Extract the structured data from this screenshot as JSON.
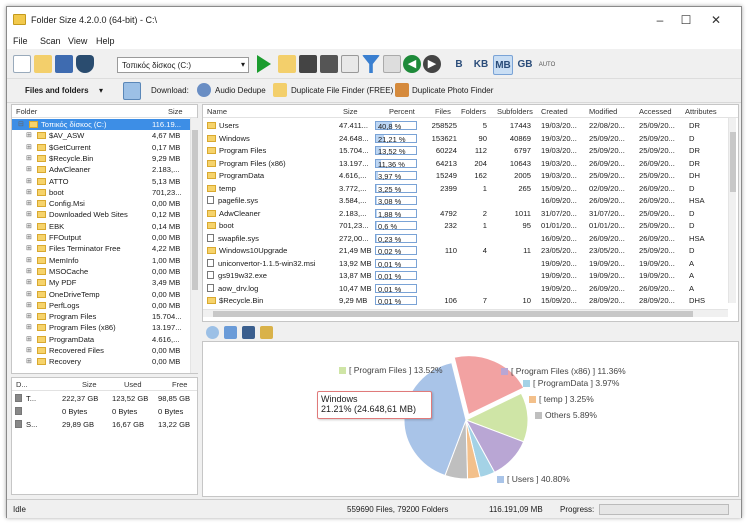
{
  "window": {
    "title": "Folder Size 4.2.0.0 (64-bit) - C:\\"
  },
  "menu": [
    "File",
    "Scan",
    "View",
    "Help"
  ],
  "toolbar": {
    "drive": "Τοπικός δίσκος (C:)",
    "units": [
      "B",
      "KB",
      "MB",
      "GB"
    ],
    "auto_label": "AUTO",
    "selected_unit": "MB"
  },
  "toolbar2": {
    "view": "Files and folders",
    "download": "Download:",
    "audio": "Audio Dedupe",
    "dup_file": "Duplicate File Finder (FREE)",
    "dup_photo": "Duplicate Photo Finder"
  },
  "tree": {
    "headers": [
      "Folder",
      "Size"
    ],
    "items": [
      {
        "name": "Τοπικός δίσκος (C:)",
        "size": "116.19..."
      },
      {
        "name": "$AV_ASW",
        "size": "4,67 MB"
      },
      {
        "name": "$GetCurrent",
        "size": "0,17 MB"
      },
      {
        "name": "$Recycle.Bin",
        "size": "9,29 MB"
      },
      {
        "name": "AdwCleaner",
        "size": "2.183,..."
      },
      {
        "name": "ATTO",
        "size": "5,13 MB"
      },
      {
        "name": "boot",
        "size": "701,23..."
      },
      {
        "name": "Config.Msi",
        "size": "0,00 MB"
      },
      {
        "name": "Downloaded Web Sites",
        "size": "0,12 MB"
      },
      {
        "name": "EBK",
        "size": "0,14 MB"
      },
      {
        "name": "FFOutput",
        "size": "0,00 MB"
      },
      {
        "name": "Files Terminator Free",
        "size": "4,22 MB"
      },
      {
        "name": "MemInfo",
        "size": "1,00 MB"
      },
      {
        "name": "MSOCache",
        "size": "0,00 MB"
      },
      {
        "name": "My PDF",
        "size": "3,49 MB"
      },
      {
        "name": "OneDriveTemp",
        "size": "0,00 MB"
      },
      {
        "name": "PerfLogs",
        "size": "0,00 MB"
      },
      {
        "name": "Program Files",
        "size": "15.704..."
      },
      {
        "name": "Program Files (x86)",
        "size": "13.197..."
      },
      {
        "name": "ProgramData",
        "size": "4.616,..."
      },
      {
        "name": "Recovered Files",
        "size": "0,00 MB"
      },
      {
        "name": "Recovery",
        "size": "0,00 MB"
      }
    ]
  },
  "drives": {
    "headers": [
      "D...",
      "Size",
      "Used",
      "Free"
    ],
    "rows": [
      {
        "d": "T...",
        "size": "222,37 GB",
        "used": "123,52 GB",
        "free": "98,85 GB"
      },
      {
        "d": "",
        "size": "0 Bytes",
        "used": "0 Bytes",
        "free": "0 Bytes"
      },
      {
        "d": "S...",
        "size": "29,89 GB",
        "used": "16,67 GB",
        "free": "13,22 GB"
      }
    ]
  },
  "list": {
    "headers": [
      "Name",
      "Size",
      "Percent",
      "Files",
      "Folders",
      "Subfolders",
      "Created",
      "Modified",
      "Accessed",
      "Attributes"
    ],
    "rows": [
      {
        "name": "Users",
        "size": "47.411...",
        "pct": "40,8 %",
        "p": 40.8,
        "files": "258525",
        "folders": "5",
        "sub": "17443",
        "created": "19/03/20...",
        "modified": "22/08/20...",
        "accessed": "25/09/20...",
        "attr": "DR",
        "type": "folder"
      },
      {
        "name": "Windows",
        "size": "24.648...",
        "pct": "21,21 %",
        "p": 21.21,
        "files": "153621",
        "folders": "90",
        "sub": "40869",
        "created": "19/03/20...",
        "modified": "25/09/20...",
        "accessed": "25/09/20...",
        "attr": "D",
        "type": "folder"
      },
      {
        "name": "Program Files",
        "size": "15.704...",
        "pct": "13,52 %",
        "p": 13.52,
        "files": "60224",
        "folders": "112",
        "sub": "6797",
        "created": "19/03/20...",
        "modified": "25/09/20...",
        "accessed": "25/09/20...",
        "attr": "DR",
        "type": "folder"
      },
      {
        "name": "Program Files (x86)",
        "size": "13.197...",
        "pct": "11,36 %",
        "p": 11.36,
        "files": "64213",
        "folders": "204",
        "sub": "10643",
        "created": "19/03/20...",
        "modified": "26/09/20...",
        "accessed": "26/09/20...",
        "attr": "DR",
        "type": "folder"
      },
      {
        "name": "ProgramData",
        "size": "4.616,...",
        "pct": "3,97 %",
        "p": 3.97,
        "files": "15249",
        "folders": "162",
        "sub": "2005",
        "created": "19/03/20...",
        "modified": "25/09/20...",
        "accessed": "25/09/20...",
        "attr": "DH",
        "type": "folder"
      },
      {
        "name": "temp",
        "size": "3.772,...",
        "pct": "3,25 %",
        "p": 3.25,
        "files": "2399",
        "folders": "1",
        "sub": "265",
        "created": "15/09/20...",
        "modified": "02/09/20...",
        "accessed": "26/09/20...",
        "attr": "D",
        "type": "folder"
      },
      {
        "name": "pagefile.sys",
        "size": "3.584,...",
        "pct": "3,08 %",
        "p": 3.08,
        "files": "",
        "folders": "",
        "sub": "",
        "created": "16/09/20...",
        "modified": "26/09/20...",
        "accessed": "26/09/20...",
        "attr": "HSA",
        "type": "file"
      },
      {
        "name": "AdwCleaner",
        "size": "2.183,...",
        "pct": "1,88 %",
        "p": 1.88,
        "files": "4792",
        "folders": "2",
        "sub": "1011",
        "created": "31/07/20...",
        "modified": "31/07/20...",
        "accessed": "25/09/20...",
        "attr": "D",
        "type": "folder"
      },
      {
        "name": "boot",
        "size": "701,23...",
        "pct": "0,6 %",
        "p": 0.6,
        "files": "232",
        "folders": "1",
        "sub": "95",
        "created": "01/01/20...",
        "modified": "01/01/20...",
        "accessed": "25/09/20...",
        "attr": "D",
        "type": "folder"
      },
      {
        "name": "swapfile.sys",
        "size": "272,00...",
        "pct": "0,23 %",
        "p": 0.23,
        "files": "",
        "folders": "",
        "sub": "",
        "created": "16/09/20...",
        "modified": "26/09/20...",
        "accessed": "26/09/20...",
        "attr": "HSA",
        "type": "file"
      },
      {
        "name": "Windows10Upgrade",
        "size": "21,49 MB",
        "pct": "0,02 %",
        "p": 0.02,
        "files": "110",
        "folders": "4",
        "sub": "11",
        "created": "23/05/20...",
        "modified": "23/05/20...",
        "accessed": "25/09/20...",
        "attr": "D",
        "type": "folder"
      },
      {
        "name": "uniconvertor-1.1.5-win32.msi",
        "size": "13,92 MB",
        "pct": "0,01 %",
        "p": 0.01,
        "files": "",
        "folders": "",
        "sub": "",
        "created": "19/09/20...",
        "modified": "19/09/20...",
        "accessed": "19/09/20...",
        "attr": "A",
        "type": "file"
      },
      {
        "name": "gs919w32.exe",
        "size": "13,87 MB",
        "pct": "0,01 %",
        "p": 0.01,
        "files": "",
        "folders": "",
        "sub": "",
        "created": "19/09/20...",
        "modified": "19/09/20...",
        "accessed": "19/09/20...",
        "attr": "A",
        "type": "file"
      },
      {
        "name": "aow_drv.log",
        "size": "10,47 MB",
        "pct": "0,01 %",
        "p": 0.01,
        "files": "",
        "folders": "",
        "sub": "",
        "created": "19/09/20...",
        "modified": "26/09/20...",
        "accessed": "26/09/20...",
        "attr": "A",
        "type": "file"
      },
      {
        "name": "$Recycle.Bin",
        "size": "9,29 MB",
        "pct": "0,01 %",
        "p": 0.01,
        "files": "106",
        "folders": "7",
        "sub": "10",
        "created": "15/09/20...",
        "modified": "28/09/20...",
        "accessed": "28/09/20...",
        "attr": "DHS",
        "type": "folder"
      }
    ]
  },
  "chart_data": {
    "type": "pie",
    "slices": [
      {
        "label": "[ Users ] 40.80%",
        "value": 40.8,
        "color": "#a9c4e8"
      },
      {
        "label": "Windows 21.21% (24.648,61 MB)",
        "value": 21.21,
        "color": "#f2a2a2"
      },
      {
        "label": "[ Program Files ] 13.52%",
        "value": 13.52,
        "color": "#cfe5a6"
      },
      {
        "label": "[ Program Files (x86) ] 11.36%",
        "value": 11.36,
        "color": "#b9a6d4"
      },
      {
        "label": "[ ProgramData ] 3.97%",
        "value": 3.97,
        "color": "#a4d2e6"
      },
      {
        "label": "[ temp ] 3.25%",
        "value": 3.25,
        "color": "#f3c08b"
      },
      {
        "label": "Others 5.89%",
        "value": 5.89,
        "color": "#bfbfbf"
      }
    ],
    "tooltip": {
      "line1": "Windows",
      "line2": "21.21% (24.648,61 MB)"
    },
    "legend_texts": {
      "pf": "[ Program Files ] 13.52%",
      "pfx": "[ Program Files (x86) ] 11.36%",
      "pd": "[ ProgramData ] 3.97%",
      "temp": "[ temp ] 3.25%",
      "others": "Others 5.89%",
      "users": "[ Users ] 40.80%"
    }
  },
  "status": {
    "state": "Idle",
    "counts": "559690 Files, 79200 Folders",
    "total": "116.191,09 MB",
    "progress": "Progress:"
  }
}
